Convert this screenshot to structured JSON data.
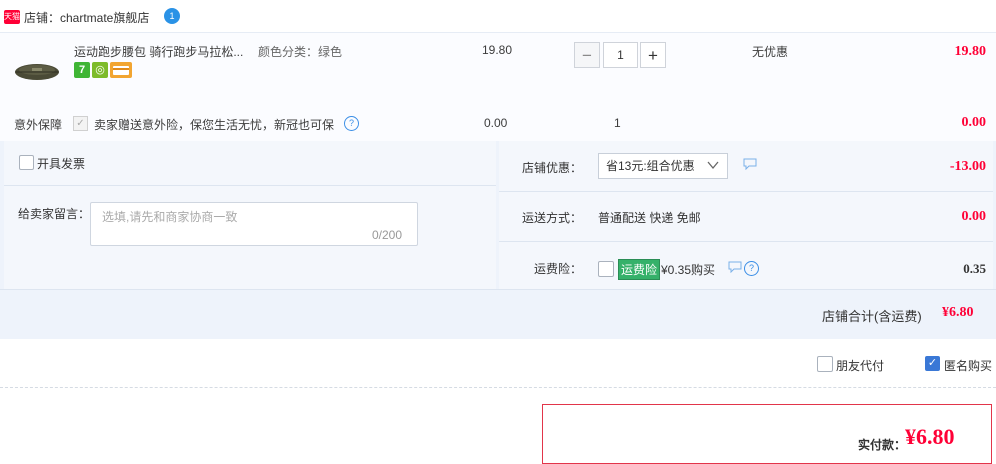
{
  "store": {
    "badge_text": "天猫",
    "label": "店铺：chartmate旗舰店",
    "wangwang_icon": "chat-bubble-icon"
  },
  "item": {
    "title": "运动跑步腰包 骑行跑步马拉松...",
    "sku": "颜色分类：绿色",
    "badges": [
      {
        "name": "seven-day-return-icon",
        "text": "7"
      },
      {
        "name": "insurance-icon",
        "text": "◎"
      },
      {
        "name": "credit-card-icon",
        "text": ""
      }
    ],
    "unit_price": "19.80",
    "quantity": "1",
    "minus": "−",
    "plus": "+",
    "promotion": "无优惠",
    "total": "19.80"
  },
  "insurance": {
    "label": "意外保障",
    "description": "卖家赠送意外险，保您生活无忧，新冠也可保",
    "price": "0.00",
    "quantity": "1",
    "total": "0.00"
  },
  "options": {
    "invoice_label": "开具发票",
    "message_label": "给卖家留言：",
    "message_placeholder": "选填,请先和商家协商一致",
    "message_count": "0/200",
    "shop_promo_label": "店铺优惠：",
    "shop_promo_value": "省13元:组合优惠",
    "shop_promo_amount": "-13.00",
    "shipping_label": "运送方式：",
    "shipping_value": "普通配送 快递 免邮",
    "shipping_amount": "0.00",
    "freight_ins_label": "运费险：",
    "freight_ins_tag": "运费险",
    "freight_ins_price": "¥0.35购买",
    "freight_ins_amount": "0.35"
  },
  "subtotal": {
    "label": "店铺合计(含运费)",
    "amount": "¥6.80"
  },
  "footer": {
    "friend_pay_label": "朋友代付",
    "anonymous_label": "匿名购买",
    "pay_label": "实付款：",
    "pay_amount": "¥6.80"
  },
  "colors": {
    "price_red": "#ff0036",
    "panel_blue": "#eef3fb",
    "check_blue": "#3a78d6",
    "freight_tag_green": "#35b16a"
  }
}
